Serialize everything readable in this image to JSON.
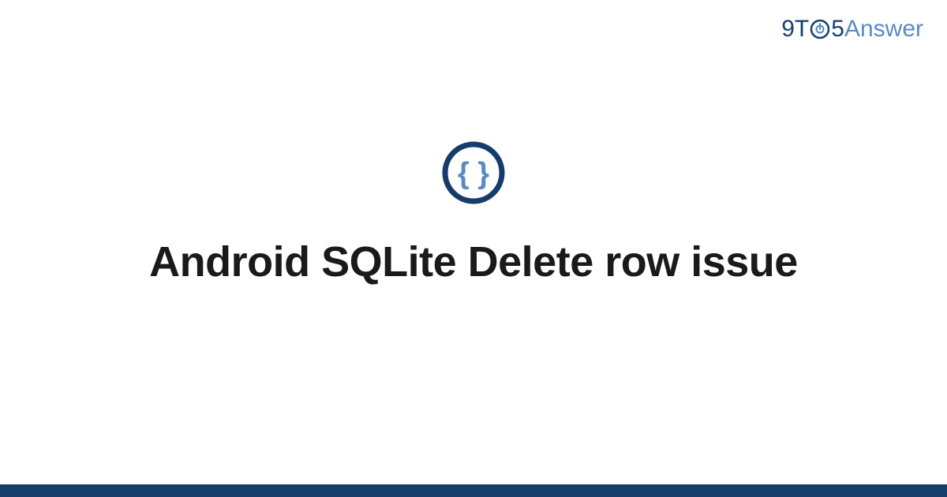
{
  "logo": {
    "part1": "9T",
    "part2": "5",
    "part3": "Answer"
  },
  "title": "Android SQLite Delete row issue",
  "colors": {
    "primary_dark": "#153c6b",
    "primary_light": "#5a8ac6"
  }
}
